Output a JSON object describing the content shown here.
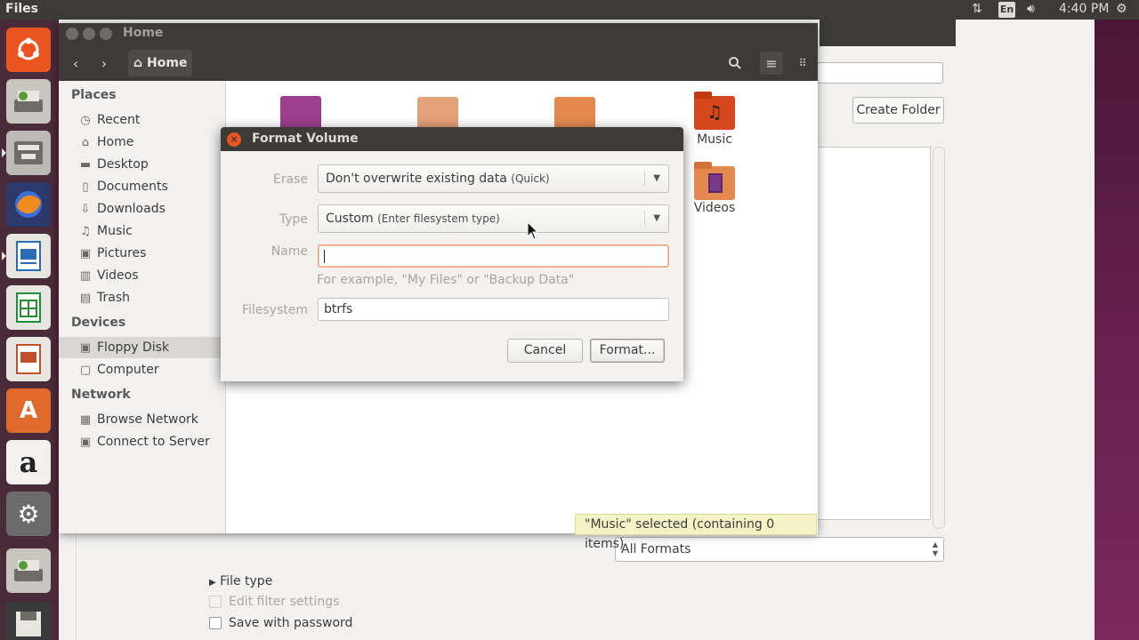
{
  "topbar": {
    "app_name": "Files",
    "keyboard_layout": "En",
    "clock": "4:40 PM",
    "icons": [
      "network-arrows-icon",
      "keyboard-layout-icon",
      "volume-icon",
      "gear-icon"
    ]
  },
  "launcher": {
    "items": [
      {
        "name": "ubuntu-dash-icon",
        "color": "#e95420",
        "glyph": "◎"
      },
      {
        "name": "disks-icon",
        "color": "#8b9a6c",
        "glyph": "▭"
      },
      {
        "name": "files-icon",
        "color": "#8a8780",
        "glyph": "▤"
      },
      {
        "name": "firefox-icon",
        "color": "#e66000",
        "glyph": "◉"
      },
      {
        "name": "writer-icon",
        "color": "#2a6db4",
        "glyph": "▦"
      },
      {
        "name": "calc-icon",
        "color": "#1f8c3a",
        "glyph": "▦"
      },
      {
        "name": "impress-icon",
        "color": "#c0502c",
        "glyph": "▦"
      },
      {
        "name": "software-center-icon",
        "color": "#e06a2c",
        "glyph": "A"
      },
      {
        "name": "amazon-icon",
        "color": "#2b2b2b",
        "glyph": "a"
      },
      {
        "name": "system-settings-icon",
        "color": "#6b6b6b",
        "glyph": "⚙"
      },
      {
        "name": "disks2-icon",
        "color": "#8b9a6c",
        "glyph": "▭"
      },
      {
        "name": "floppy-icon",
        "color": "#3a3a3a",
        "glyph": "▬"
      }
    ]
  },
  "background_app": {
    "create_folder_label": "Create Folder",
    "format_filter": "All Formats",
    "file_type_label": "File type",
    "edit_filter_label": "Edit filter settings",
    "save_password_label": "Save with password"
  },
  "files_window": {
    "title": "Home",
    "breadcrumb": "Home",
    "sidebar": {
      "places_header": "Places",
      "places": [
        {
          "label": "Recent",
          "icon": "clock-icon",
          "glyph": "◷"
        },
        {
          "label": "Home",
          "icon": "home-icon",
          "glyph": "⌂"
        },
        {
          "label": "Desktop",
          "icon": "desktop-folder-icon",
          "glyph": "▬"
        },
        {
          "label": "Documents",
          "icon": "documents-icon",
          "glyph": "▯"
        },
        {
          "label": "Downloads",
          "icon": "downloads-icon",
          "glyph": "⇩"
        },
        {
          "label": "Music",
          "icon": "music-icon",
          "glyph": "♫"
        },
        {
          "label": "Pictures",
          "icon": "pictures-icon",
          "glyph": "▣"
        },
        {
          "label": "Videos",
          "icon": "videos-icon",
          "glyph": "▥"
        },
        {
          "label": "Trash",
          "icon": "trash-icon",
          "glyph": "▤"
        }
      ],
      "devices_header": "Devices",
      "devices": [
        {
          "label": "Floppy Disk",
          "icon": "floppy-disk-icon",
          "glyph": "▣",
          "selected": true
        },
        {
          "label": "Computer",
          "icon": "computer-icon",
          "glyph": "▢"
        }
      ],
      "network_header": "Network",
      "network": [
        {
          "label": "Browse Network",
          "icon": "browse-network-icon",
          "glyph": "▦"
        },
        {
          "label": "Connect to Server",
          "icon": "connect-server-icon",
          "glyph": "▣"
        }
      ]
    },
    "folders": [
      {
        "label": "Music",
        "icon": "music-folder-icon"
      },
      {
        "label": "Videos",
        "icon": "videos-folder-icon"
      }
    ],
    "status": "\"Music\" selected  (containing 0 items)"
  },
  "format_dialog": {
    "title": "Format Volume",
    "erase_label": "Erase",
    "erase_value": "Don't overwrite existing data",
    "erase_hint": "(Quick)",
    "type_label": "Type",
    "type_value": "Custom",
    "type_hint": "(Enter filesystem type)",
    "name_label": "Name",
    "name_value": "",
    "name_hint": "For example, \"My Files\" or \"Backup Data\"",
    "filesystem_label": "Filesystem",
    "filesystem_value": "btrfs",
    "cancel_label": "Cancel",
    "format_label": "Format..."
  }
}
